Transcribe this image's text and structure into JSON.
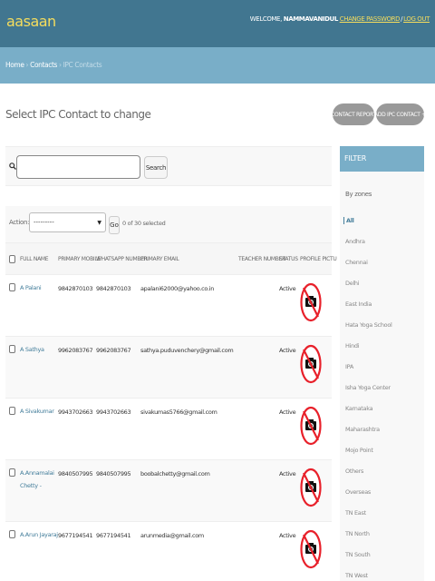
{
  "header": {
    "brand": "aasaan",
    "welcome": "WELCOME,",
    "username": "NAMMAVANIDUL",
    "change_password": "CHANGE PASSWORD",
    "separator": "/",
    "logout": "LOG OUT"
  },
  "breadcrumbs": {
    "home": "Home",
    "sep1": "›",
    "contacts": "Contacts",
    "sep2": "›",
    "current": "IPC Contacts"
  },
  "page": {
    "title": "Select IPC Contact to change"
  },
  "object_tools": {
    "report": "CONTACT REPORT",
    "add": "ADD IPC CONTACT +"
  },
  "search": {
    "value": "",
    "placeholder": "",
    "button": "Search"
  },
  "actions": {
    "label": "Action:",
    "selected_option": "---------",
    "go": "Go",
    "selected_info": "0 of 30 selected"
  },
  "table": {
    "columns": [
      "FULL NAME",
      "PRIMARY MOBILE",
      "WHATSAPP NUMBER",
      "PRIMARY EMAIL",
      "TEACHER NUMBER",
      "STATUS",
      "PROFILE PICTU"
    ],
    "rows": [
      {
        "name": "A Palani",
        "mobile": "9842870103",
        "whatsapp": "9842870103",
        "email": "apalani62000@yahoo.co.in",
        "teacher": "",
        "status": "Active",
        "picture": "no-camera-icon"
      },
      {
        "name": "A Sathya",
        "mobile": "9962083767",
        "whatsapp": "9962083767",
        "email": "sathya.puduvenchery@gmail.com",
        "teacher": "",
        "status": "Active",
        "picture": "no-camera-icon"
      },
      {
        "name": "A Sivakumar",
        "mobile": "9943702663",
        "whatsapp": "9943702663",
        "email": "sivakumas5766@gmail.com",
        "teacher": "",
        "status": "Active",
        "picture": "no-camera-icon"
      },
      {
        "name": "A.Annamalai Chetty -",
        "mobile": "9840507995",
        "whatsapp": "9840507995",
        "email": "boobalchetty@gmail.com",
        "teacher": "",
        "status": "Active",
        "picture": "no-camera-icon"
      },
      {
        "name": "A.Arun Jayaraj",
        "mobile": "9677194541",
        "whatsapp": "9677194541",
        "email": "arunmedia@gmail.com",
        "teacher": "",
        "status": "Active",
        "picture": "no-camera-icon"
      }
    ]
  },
  "filter": {
    "header": "FILTER",
    "subtitle": "By zones",
    "items": [
      "All",
      "Andhra",
      "Chennai",
      "Delhi",
      "East India",
      "Hata Yoga School",
      "Hindi",
      "IPA",
      "Isha Yoga Center",
      "Karnataka",
      "Maharashtra",
      "Mojo Point",
      "Others",
      "Overseas",
      "TN East",
      "TN North",
      "TN South",
      "TN West"
    ]
  },
  "colors": {
    "header_bg": "#417690",
    "breadcrumb_bg": "#79aec8",
    "brand": "#f5dd5d",
    "link": "#447e9b",
    "button_gray": "#999999"
  }
}
